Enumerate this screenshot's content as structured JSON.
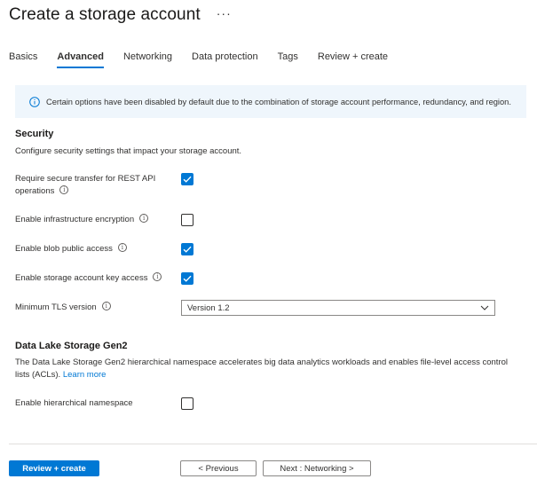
{
  "header": {
    "title": "Create a storage account",
    "more_label": "···"
  },
  "tabs": [
    {
      "label": "Basics",
      "active": false
    },
    {
      "label": "Advanced",
      "active": true
    },
    {
      "label": "Networking",
      "active": false
    },
    {
      "label": "Data protection",
      "active": false
    },
    {
      "label": "Tags",
      "active": false
    },
    {
      "label": "Review + create",
      "active": false
    }
  ],
  "info": {
    "icon": "info-icon",
    "text": "Certain options have been disabled by default due to the combination of storage account performance, redundancy, and region."
  },
  "security": {
    "title": "Security",
    "description": "Configure security settings that impact your storage account.",
    "fields": {
      "secure_transfer": {
        "label_line1": "Require secure transfer for REST API",
        "label_line2": "operations",
        "checked": true
      },
      "infra_encryption": {
        "label": "Enable infrastructure encryption",
        "checked": false
      },
      "blob_public": {
        "label": "Enable blob public access",
        "checked": true
      },
      "key_access": {
        "label": "Enable storage account key access",
        "checked": true
      },
      "tls": {
        "label": "Minimum TLS version",
        "value": "Version 1.2"
      }
    }
  },
  "datalake": {
    "title": "Data Lake Storage Gen2",
    "description": "The Data Lake Storage Gen2 hierarchical namespace accelerates big data analytics workloads and enables file-level access control lists (ACLs).",
    "link": "Learn more",
    "hns": {
      "label": "Enable hierarchical namespace",
      "checked": false
    }
  },
  "footer": {
    "review_create": "Review + create",
    "previous": "< Previous",
    "next": "Next : Networking >"
  },
  "colors": {
    "accent": "#0078d4",
    "info_bg": "#eff6fc"
  }
}
